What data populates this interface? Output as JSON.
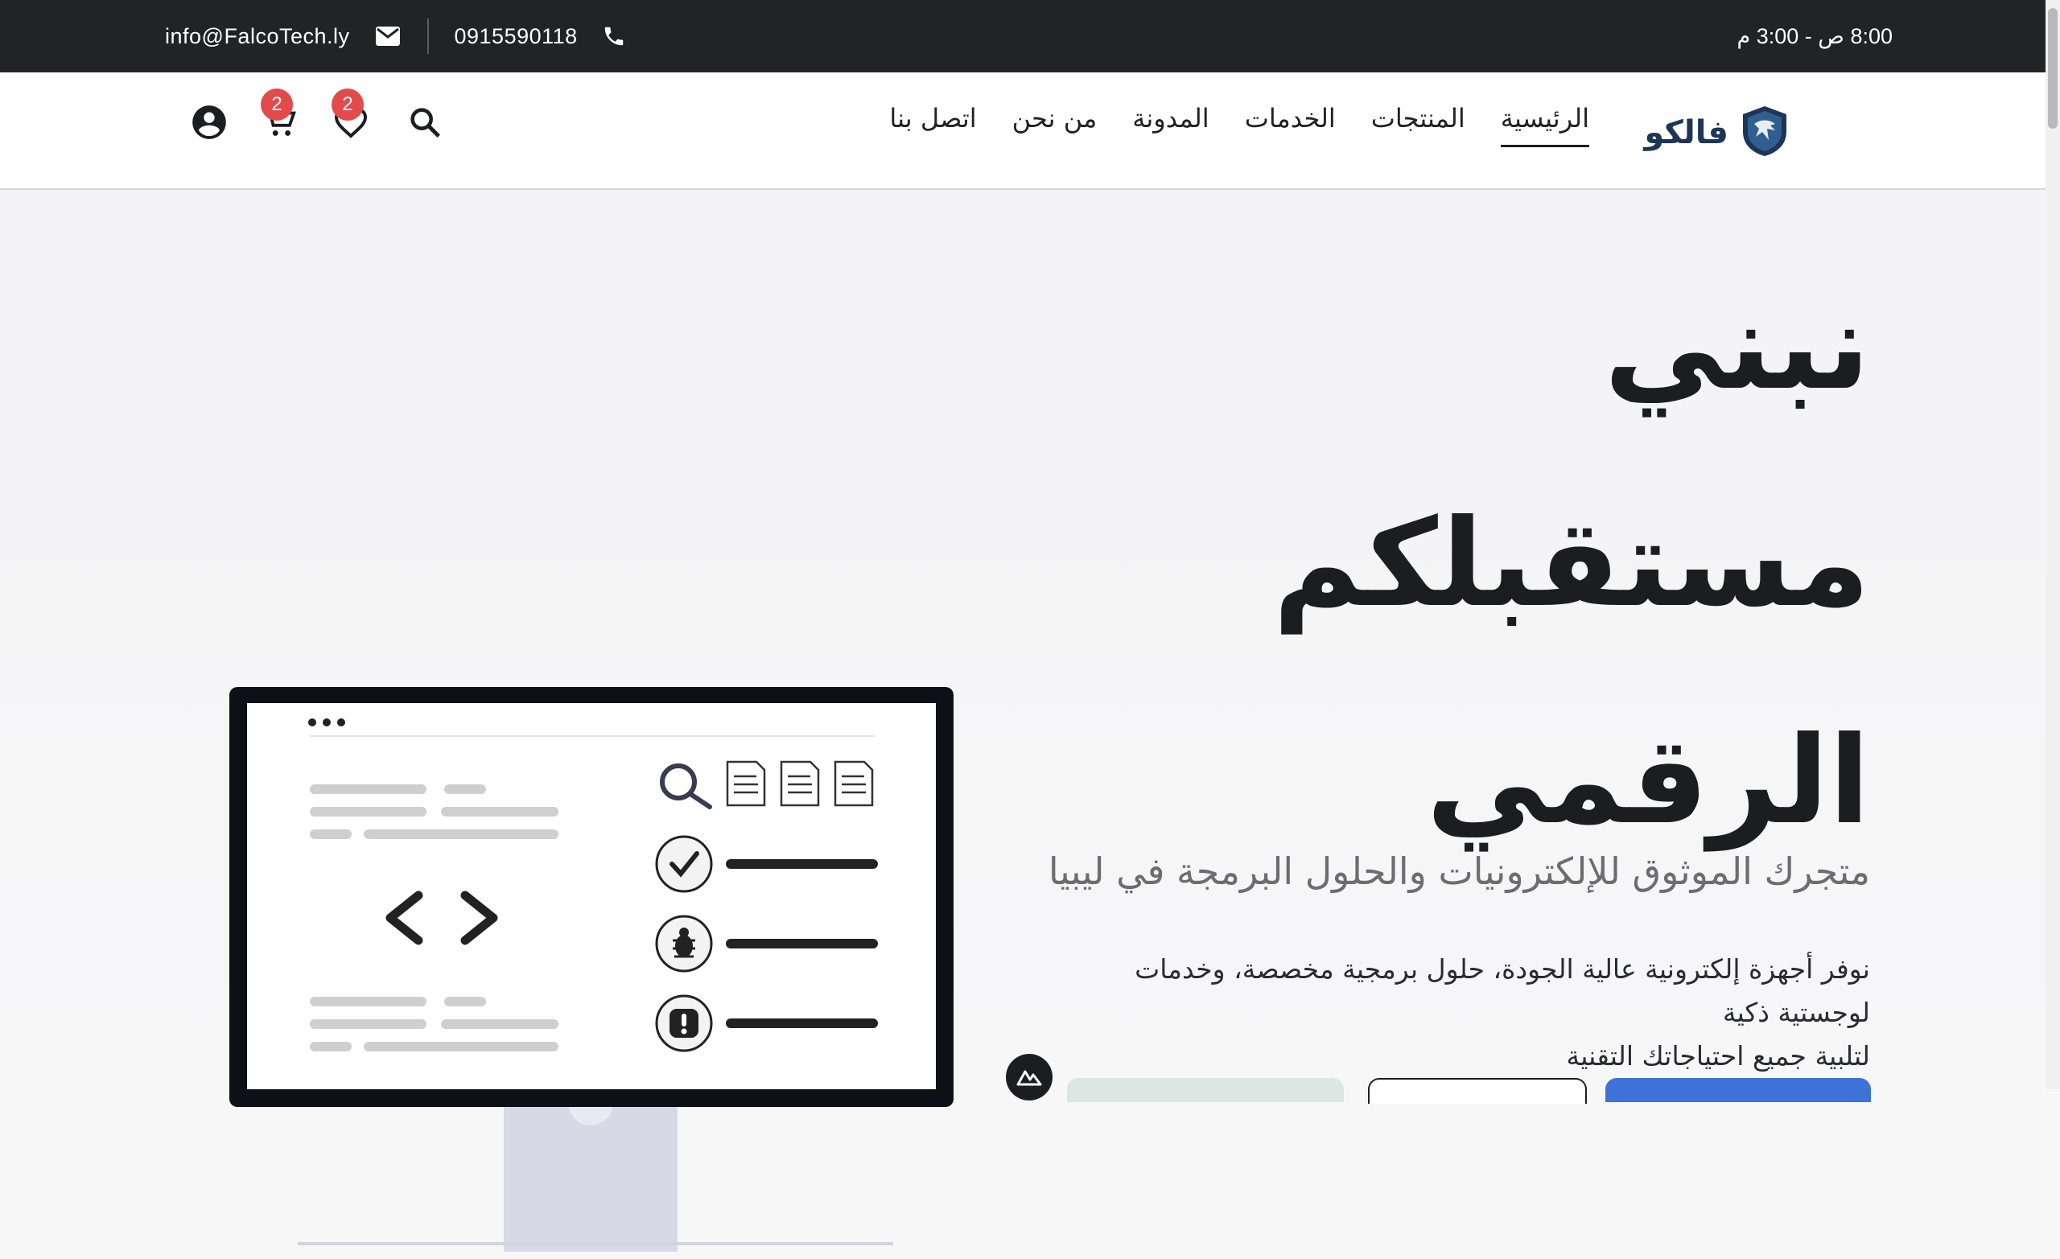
{
  "topbar": {
    "email": "info@FalcoTech.ly",
    "phone": "0915590118",
    "hours": "8:00 ص - 3:00 م"
  },
  "header": {
    "logo_text": "فالكو",
    "nav": [
      {
        "label": "الرئيسية",
        "active": true
      },
      {
        "label": "المنتجات",
        "active": false
      },
      {
        "label": "الخدمات",
        "active": false
      },
      {
        "label": "المدونة",
        "active": false
      },
      {
        "label": "من نحن",
        "active": false
      },
      {
        "label": "اتصل بنا",
        "active": false
      }
    ],
    "wishlist_count": "2",
    "cart_count": "2"
  },
  "hero": {
    "title_line1": "نبني",
    "title_line2": "مستقبلكم",
    "title_line3": "الرقمي",
    "subtitle": "متجرك الموثوق للإلكترونيات والحلول البرمجة في ليبيا",
    "description_line1": "نوفر أجهزة إلكترونية عالية الجودة، حلول برمجية مخصصة، وخدمات لوجستية ذكية",
    "description_line2": "لتلبية جميع احتياجاتك التقنية"
  },
  "icons": {
    "email": "mail-icon",
    "phone": "phone-icon",
    "search": "search-icon",
    "wishlist": "heart-icon",
    "cart": "cart-icon",
    "account": "account-circle-icon"
  },
  "colors": {
    "topbar_bg": "#222326",
    "badge": "#e24b4b",
    "logo": "#1d3557",
    "primary_button": "#3f72d8"
  }
}
